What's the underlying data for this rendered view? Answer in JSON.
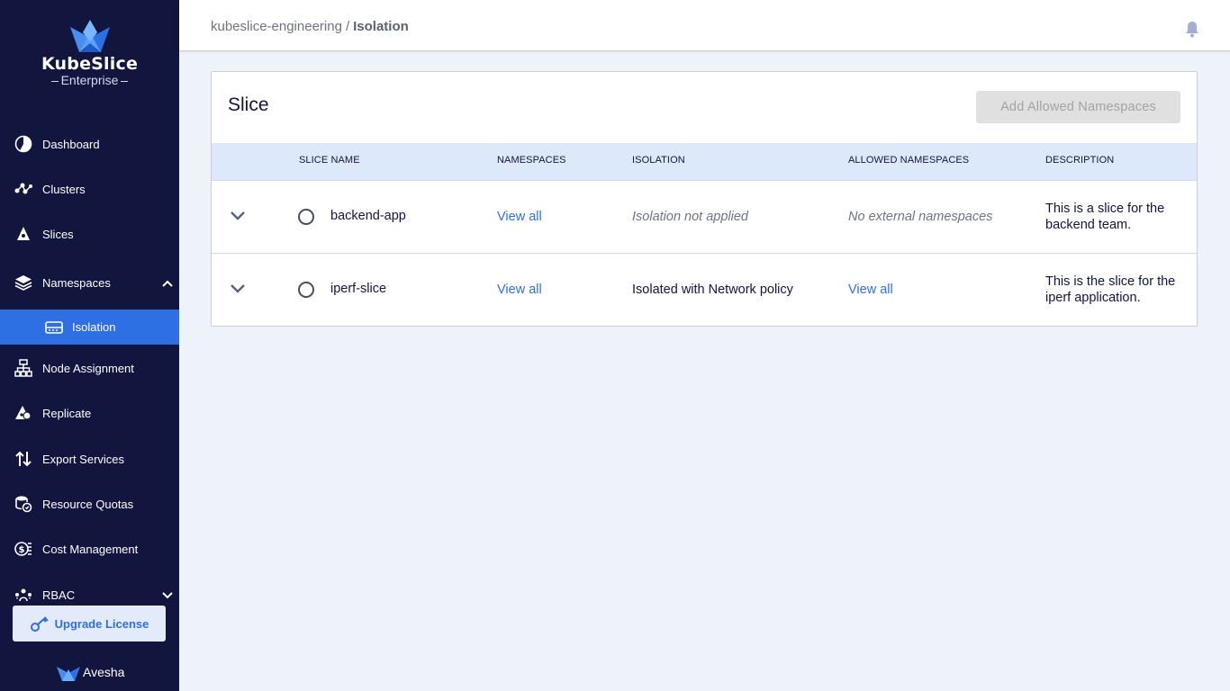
{
  "brand": {
    "title": "KubeSlice",
    "subtitle": "Enterprise",
    "footer": "Avesha"
  },
  "sidebar": {
    "items": [
      {
        "label": "Dashboard",
        "icon": "pie-chart-icon"
      },
      {
        "label": "Clusters",
        "icon": "cluster-nodes-icon"
      },
      {
        "label": "Slices",
        "icon": "slice-icon"
      },
      {
        "label": "Namespaces",
        "icon": "layers-icon",
        "expanded": true
      },
      {
        "label": "Isolation",
        "icon": "server-icon",
        "active": true
      },
      {
        "label": "Node Assignment",
        "icon": "hierarchy-icon"
      },
      {
        "label": "Replicate",
        "icon": "replicate-icon"
      },
      {
        "label": "Export Services",
        "icon": "arrows-up-down-icon"
      },
      {
        "label": "Resource Quotas",
        "icon": "coins-icon"
      },
      {
        "label": "Cost Management",
        "icon": "money-icon"
      },
      {
        "label": "RBAC",
        "icon": "users-network-icon",
        "expanded": false
      }
    ],
    "upgrade_label": "Upgrade License"
  },
  "header": {
    "breadcrumb_parent": "kubeslice-engineering",
    "breadcrumb_separator": "/",
    "breadcrumb_current": "Isolation"
  },
  "main": {
    "card_title": "Slice",
    "add_button_label": "Add Allowed Namespaces",
    "columns": [
      "SLICE NAME",
      "NAMESPACES",
      "ISOLATION",
      "ALLOWED NAMESPACES",
      "DESCRIPTION"
    ],
    "rows": [
      {
        "slice_name": "backend-app",
        "namespaces": "View all",
        "isolation": "Isolation not applied",
        "allowed_namespaces": "No external namespaces",
        "description_line1": "This is a slice for the",
        "description_line2": "backend team."
      },
      {
        "slice_name": "iperf-slice",
        "namespaces": "View all",
        "isolation": "Isolated with Network policy",
        "allowed_namespaces": "View all",
        "description_line1": "This is the slice for the",
        "description_line2": "iperf application."
      }
    ]
  },
  "colors": {
    "sidebar_bg": "#12153e",
    "accent": "#2f6fe4",
    "table_header_bg": "#dde8fb",
    "content_bg": "#eef2f9"
  }
}
